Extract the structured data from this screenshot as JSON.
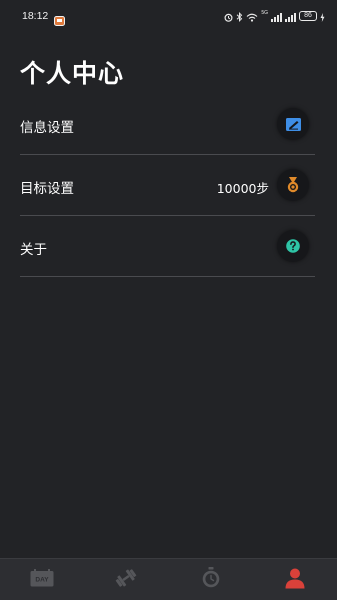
{
  "status_bar": {
    "time": "18:12",
    "network_label": "5G",
    "battery_level": "86",
    "icons": [
      "notification-app-icon",
      "alarm-icon",
      "bluetooth-icon",
      "wifi-icon",
      "signal-icon",
      "signal-icon",
      "battery-icon",
      "charging-icon"
    ]
  },
  "page": {
    "title": "个人中心"
  },
  "settings": {
    "items": [
      {
        "label": "信息设置",
        "value": "",
        "icon": "edit-icon",
        "icon_color": "#3e8ee6"
      },
      {
        "label": "目标设置",
        "value": "10000步",
        "icon": "medal-icon",
        "icon_color": "#e08a2a"
      },
      {
        "label": "关于",
        "value": "",
        "icon": "help-icon",
        "icon_color": "#2ec4a6"
      }
    ]
  },
  "bottom_nav": {
    "items": [
      {
        "name": "day-calendar-icon",
        "text": "DAY",
        "active": false
      },
      {
        "name": "dumbbell-icon",
        "active": false
      },
      {
        "name": "stopwatch-icon",
        "active": false
      },
      {
        "name": "profile-icon",
        "active": true
      }
    ],
    "inactive_color": "#55565a",
    "active_color": "#d9413a"
  }
}
